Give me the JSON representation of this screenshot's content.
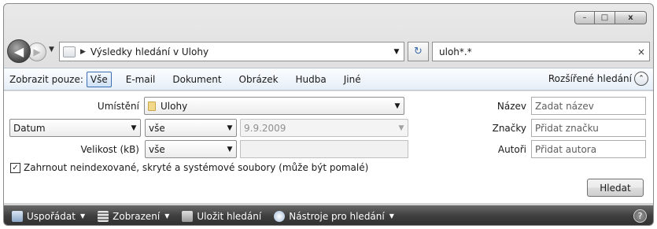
{
  "window": {
    "minimize_glyph": "–",
    "maximize_glyph": "□",
    "close_glyph": "x"
  },
  "nav": {
    "back_glyph": "◀",
    "forward_glyph": "▶",
    "recent_glyph": "▼",
    "address_separator": "▶",
    "address_path": "Výsledky hledání v Ulohy",
    "address_dropdown_glyph": "▼",
    "refresh_glyph": "↻",
    "search_query": "uloh*.*",
    "search_clear_glyph": "×"
  },
  "filterbar": {
    "show_only_label": "Zobrazit pouze:",
    "chips": [
      "Vše",
      "E-mail",
      "Dokument",
      "Obrázek",
      "Hudba",
      "Jiné"
    ],
    "selected_chip": "Vše",
    "advanced_label": "Rozšířené hledání",
    "advanced_toggle_glyph": "⌃"
  },
  "panel": {
    "location_label": "Umístění",
    "location_value": "Ulohy",
    "date_field": "Datum",
    "date_operator": "vše",
    "date_value": "9.9.2009",
    "size_label": "Velikost (kB)",
    "size_operator": "vše",
    "size_value": "",
    "include_hidden_label": "Zahrnout neindexované, skryté a systémové soubory (může být pomalé)",
    "include_hidden_checked": true,
    "check_glyph": "✓",
    "name_label": "Název",
    "name_placeholder": "Zadat název",
    "tags_label": "Značky",
    "tags_placeholder": "Přidat značku",
    "authors_label": "Autoři",
    "authors_placeholder": "Přidat autora",
    "search_button": "Hledat",
    "dropdown_glyph": "▼"
  },
  "cmdbar": {
    "organize": "Uspořádat",
    "views": "Zobrazení",
    "save_search": "Uložit hledání",
    "search_tools": "Nástroje pro hledání",
    "caret_glyph": "▼",
    "help_glyph": "?"
  },
  "colors": {
    "selected_chip_border": "#3a6db2",
    "command_bar": "#3e3e3e"
  }
}
